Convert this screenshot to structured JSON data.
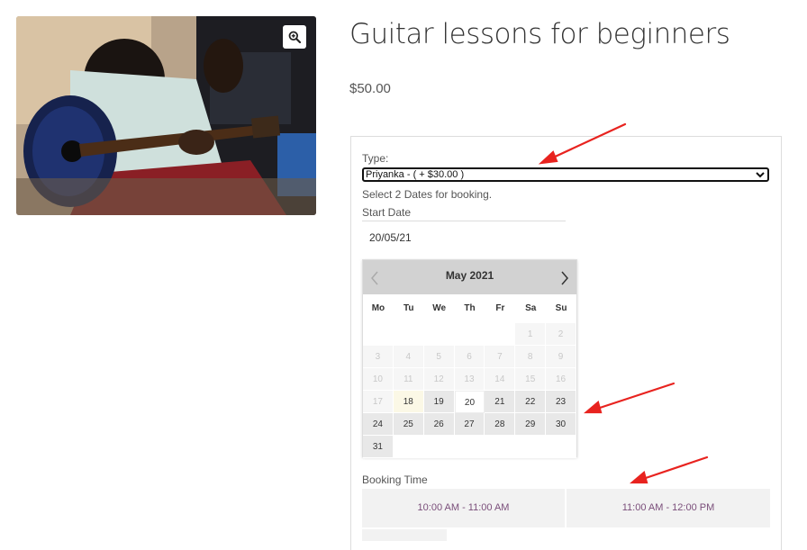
{
  "product": {
    "title": "Guitar lessons for beginners",
    "price": "$50.00",
    "image_alt": "person-playing-guitar-photo"
  },
  "form": {
    "type_label": "Type:",
    "type_selected": "Priyanka - ( + $30.00 )",
    "select_dates_hint": "Select 2 Dates for booking.",
    "start_date_label": "Start Date",
    "start_date_value": "20/05/21",
    "booking_time_label": "Booking Time"
  },
  "calendar": {
    "month_label": "May 2021",
    "weekdays": [
      "Mo",
      "Tu",
      "We",
      "Th",
      "Fr",
      "Sa",
      "Su"
    ],
    "weeks": [
      [
        {
          "d": "",
          "s": "empty"
        },
        {
          "d": "",
          "s": "empty"
        },
        {
          "d": "",
          "s": "empty"
        },
        {
          "d": "",
          "s": "empty"
        },
        {
          "d": "",
          "s": "empty"
        },
        {
          "d": "1",
          "s": "dis"
        },
        {
          "d": "2",
          "s": "dis"
        }
      ],
      [
        {
          "d": "3",
          "s": "dis"
        },
        {
          "d": "4",
          "s": "dis"
        },
        {
          "d": "5",
          "s": "dis"
        },
        {
          "d": "6",
          "s": "dis"
        },
        {
          "d": "7",
          "s": "dis"
        },
        {
          "d": "8",
          "s": "dis"
        },
        {
          "d": "9",
          "s": "dis"
        }
      ],
      [
        {
          "d": "10",
          "s": "dis"
        },
        {
          "d": "11",
          "s": "dis"
        },
        {
          "d": "12",
          "s": "dis"
        },
        {
          "d": "13",
          "s": "dis"
        },
        {
          "d": "14",
          "s": "dis"
        },
        {
          "d": "15",
          "s": "dis"
        },
        {
          "d": "16",
          "s": "dis"
        }
      ],
      [
        {
          "d": "17",
          "s": "dis"
        },
        {
          "d": "18",
          "s": "today"
        },
        {
          "d": "19",
          "s": "av"
        },
        {
          "d": "20",
          "s": "sel"
        },
        {
          "d": "21",
          "s": "av"
        },
        {
          "d": "22",
          "s": "av"
        },
        {
          "d": "23",
          "s": "av"
        }
      ],
      [
        {
          "d": "24",
          "s": "av"
        },
        {
          "d": "25",
          "s": "av"
        },
        {
          "d": "26",
          "s": "av"
        },
        {
          "d": "27",
          "s": "av"
        },
        {
          "d": "28",
          "s": "av"
        },
        {
          "d": "29",
          "s": "av"
        },
        {
          "d": "30",
          "s": "av"
        }
      ],
      [
        {
          "d": "31",
          "s": "av"
        },
        {
          "d": "",
          "s": "empty"
        },
        {
          "d": "",
          "s": "empty"
        },
        {
          "d": "",
          "s": "empty"
        },
        {
          "d": "",
          "s": "empty"
        },
        {
          "d": "",
          "s": "empty"
        },
        {
          "d": "",
          "s": "empty"
        }
      ]
    ]
  },
  "time_slots": [
    "10:00 AM - 11:00 AM",
    "11:00 AM - 12:00 PM"
  ],
  "icons": {
    "zoom": "magnifier-plus-icon",
    "prev": "chevron-left-icon",
    "next": "chevron-right-icon",
    "select_caret": "chevron-down-icon"
  },
  "colors": {
    "slot_text": "#7a4e7a",
    "annotation_arrow": "#e8231f",
    "calendar_header": "#d2d2d2"
  }
}
